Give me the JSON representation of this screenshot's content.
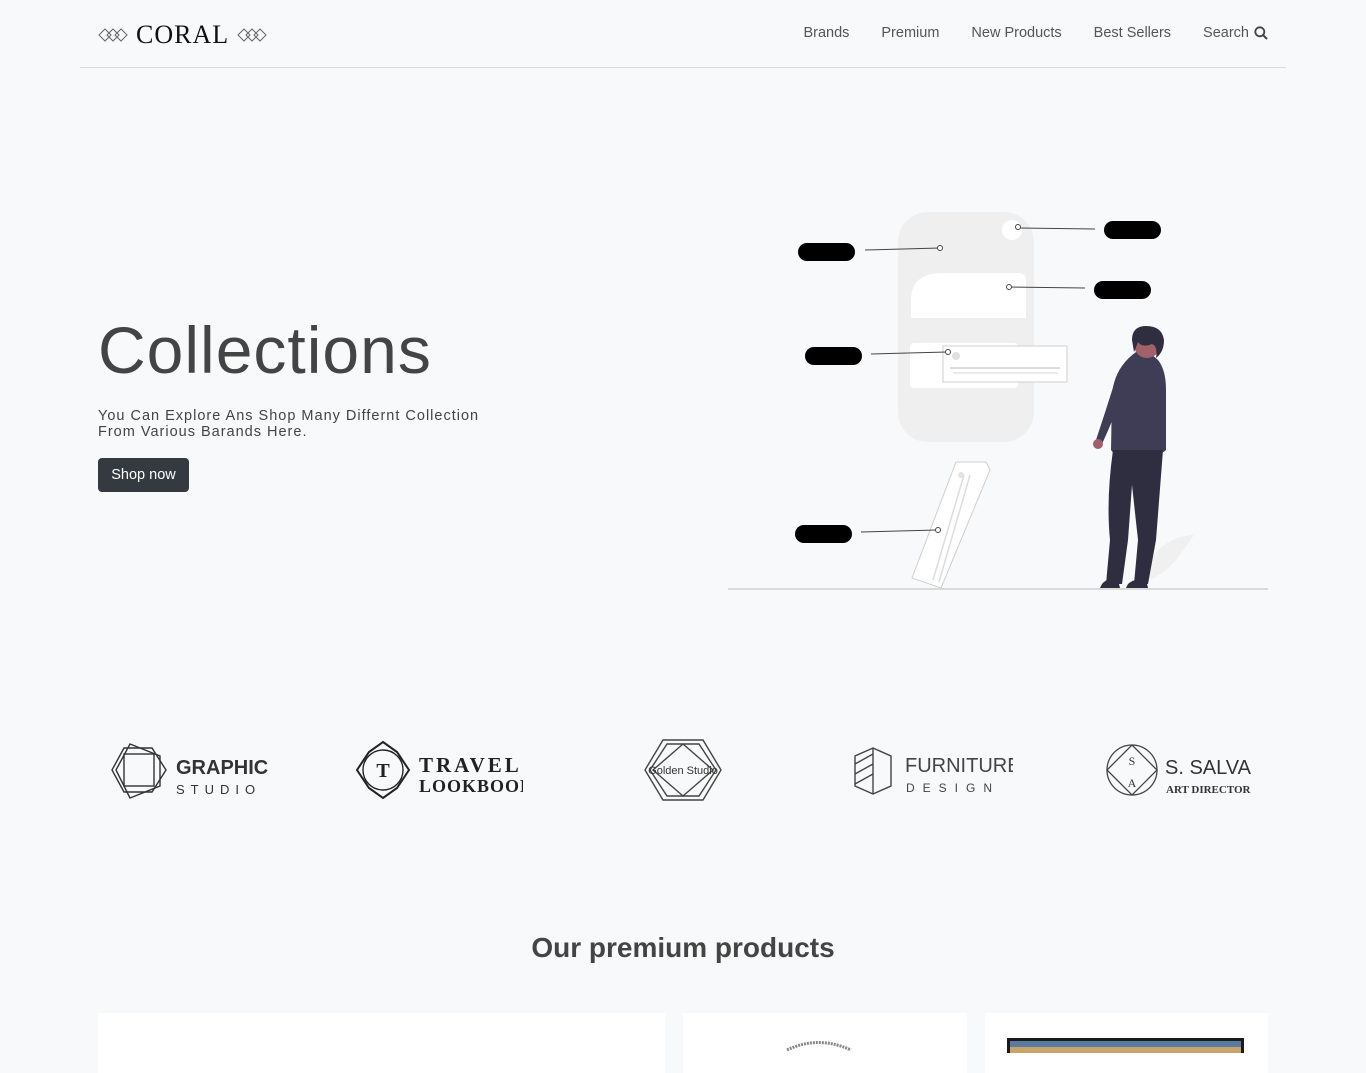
{
  "brand": {
    "name": "CORAL"
  },
  "nav": {
    "items": [
      "Brands",
      "Premium",
      "New Products",
      "Best Sellers"
    ],
    "search_label": "Search"
  },
  "hero": {
    "title": "Collections",
    "subtitle": "You Can Explore Ans Shop Many Differnt Collection From Various Barands Here.",
    "cta_label": "Shop now"
  },
  "brands": [
    {
      "line1": "GRAPHIC",
      "line2": "STUDIO"
    },
    {
      "line1": "TRAVEL",
      "line2": "LOOKBOOK",
      "mark": "T"
    },
    {
      "line1": "Golden Studio"
    },
    {
      "line1": "FURNITURE",
      "line2": "DESIGN"
    },
    {
      "line1": "S. SALVA",
      "line2": "ART DIRECTOR",
      "mark1": "S",
      "mark2": "A"
    }
  ],
  "premium": {
    "title": "Our premium products"
  },
  "colors": {
    "background": "#f8f9fa",
    "button": "#343a40",
    "figure": "#3f3d56",
    "text": "#444444"
  }
}
